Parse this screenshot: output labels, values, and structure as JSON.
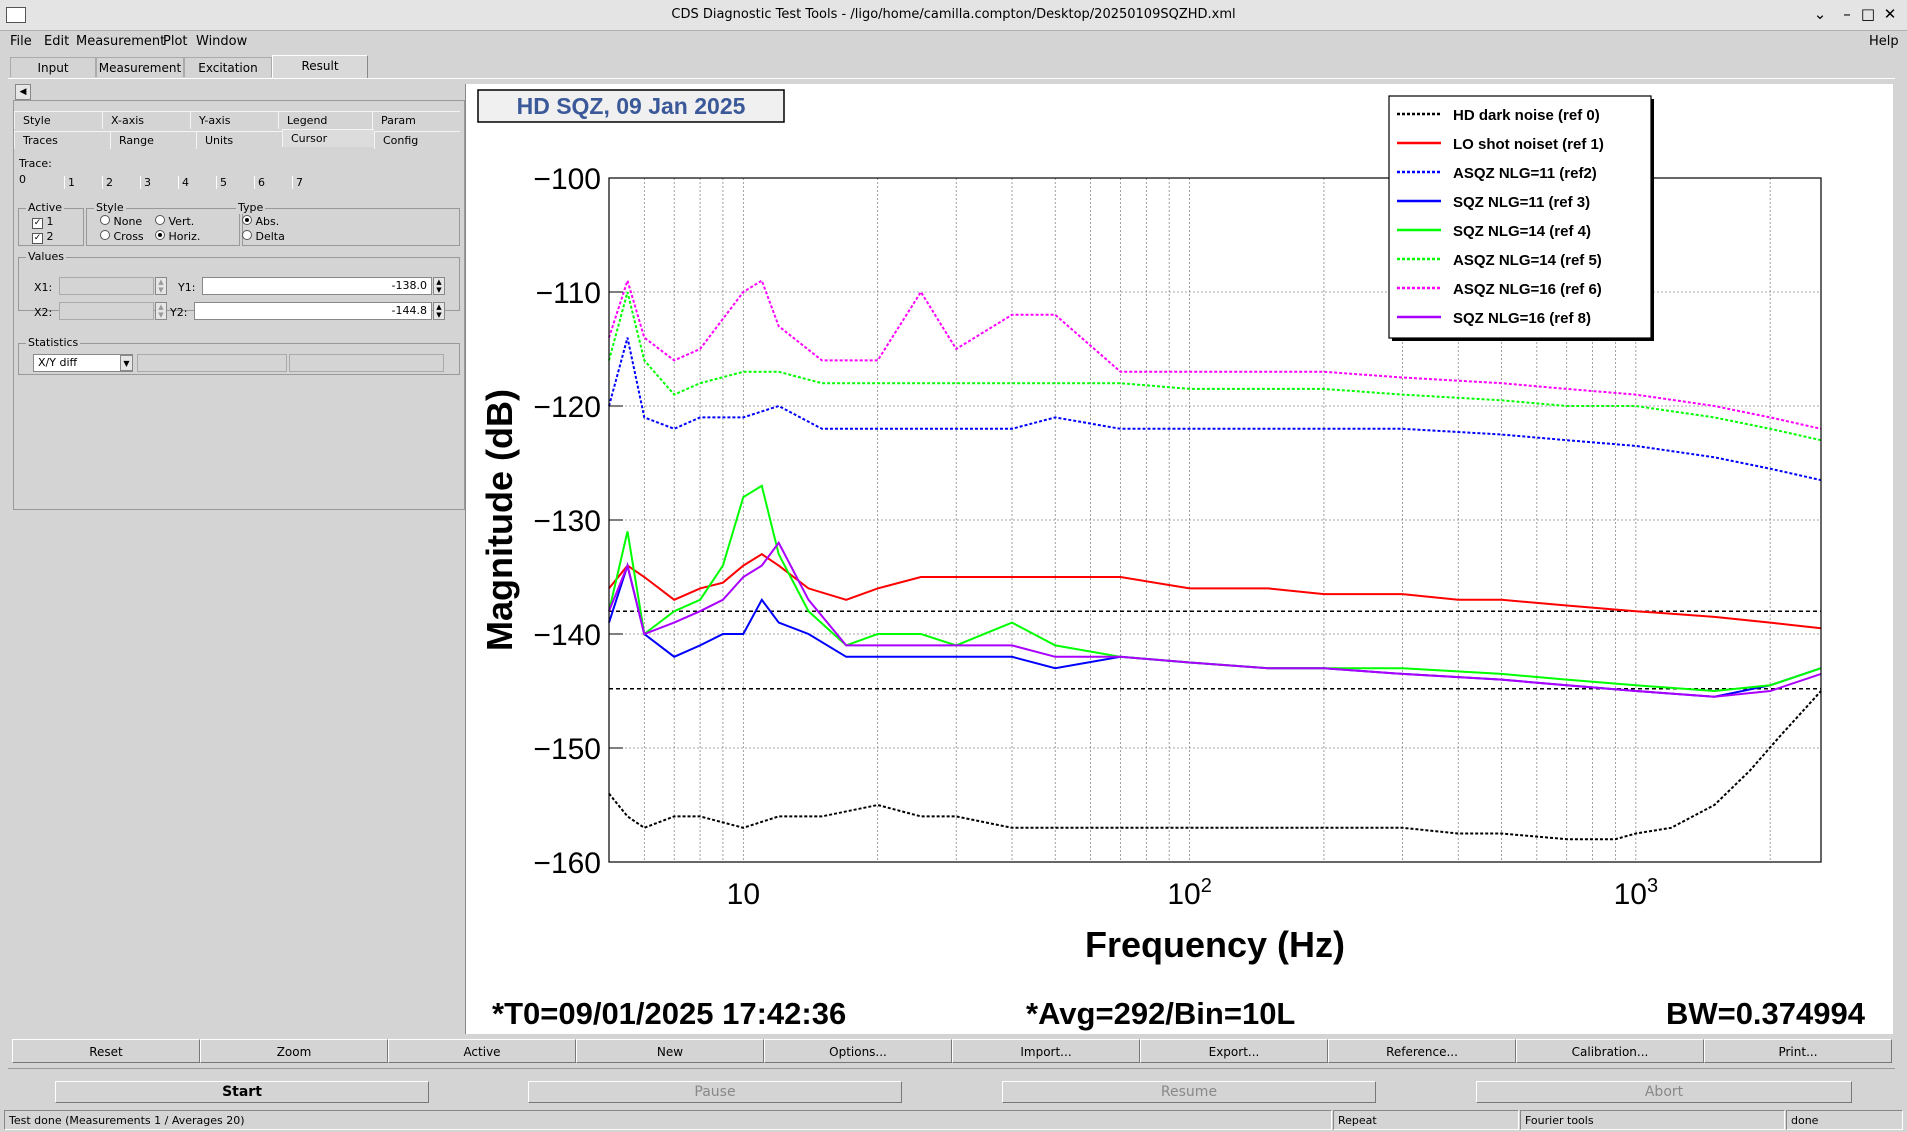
{
  "window": {
    "title": "CDS Diagnostic Test Tools - /ligo/home/camilla.compton/Desktop/20250109SQZHD.xml"
  },
  "menu": {
    "file": "File",
    "edit": "Edit",
    "measurement": "Measurement",
    "plot": "Plot",
    "window": "Window",
    "help": "Help"
  },
  "tabs": [
    "Input",
    "Measurement",
    "Excitation",
    "Result"
  ],
  "options": {
    "subtabs_row1": [
      "Style",
      "X-axis",
      "Y-axis",
      "Legend",
      "Param"
    ],
    "subtabs_row2": [
      "Traces",
      "Range",
      "Units",
      "Cursor",
      "Config"
    ],
    "trace_label": "Trace:",
    "trace_tabs": [
      "0",
      "1",
      "2",
      "3",
      "4",
      "5",
      "6",
      "7"
    ],
    "active": {
      "title": "Active",
      "item1": "1",
      "item2": "2"
    },
    "style": {
      "title": "Style",
      "none": "None",
      "vert": "Vert.",
      "cross": "Cross",
      "horiz": "Horiz."
    },
    "type": {
      "title": "Type",
      "abs": "Abs.",
      "delta": "Delta"
    },
    "values": {
      "title": "Values",
      "x1_label": "X1:",
      "x2_label": "X2:",
      "y1_label": "Y1:",
      "y2_label": "Y2:",
      "y1": "-138.0",
      "y2": "-144.8"
    },
    "statistics": {
      "title": "Statistics",
      "selected": "X/Y diff"
    }
  },
  "plot": {
    "info_t0": "*T0=09/01/2025 17:42:36",
    "info_avg": "*Avg=292/Bin=10L",
    "info_bw": "BW=0.374994"
  },
  "chart_data": {
    "type": "line",
    "title": "HD SQZ, 09 Jan 2025",
    "xlabel": "Frequency (Hz)",
    "ylabel": "Magnitude (dB)",
    "xscale": "log",
    "xlim": [
      5,
      2600
    ],
    "ylim": [
      -160,
      -100
    ],
    "ytick_labels": [
      "−100",
      "−110",
      "−120",
      "−130",
      "−140",
      "−150",
      "−160"
    ],
    "yticks": [
      -100,
      -110,
      -120,
      -130,
      -140,
      -150,
      -160
    ],
    "xtick_labels": [
      {
        "base": "10",
        "exp": ""
      },
      {
        "base": "10",
        "exp": "2"
      },
      {
        "base": "10",
        "exp": "3"
      }
    ],
    "xticks": [
      10,
      100,
      1000
    ],
    "grid": true,
    "legend_position": "top-right",
    "series": [
      {
        "name": "HD dark noise (ref 0)",
        "color": "#000000",
        "style": "dotted",
        "x": [
          5,
          5.5,
          6,
          7,
          8,
          10,
          12,
          15,
          20,
          25,
          30,
          40,
          50,
          70,
          100,
          150,
          200,
          300,
          400,
          500,
          700,
          900,
          1000,
          1200,
          1500,
          1800,
          2100,
          2400,
          2600
        ],
        "y": [
          -154,
          -156,
          -157,
          -156,
          -156,
          -157,
          -156,
          -156,
          -155,
          -156,
          -156,
          -157,
          -157,
          -157,
          -157,
          -157,
          -157,
          -157,
          -157.5,
          -157.5,
          -158,
          -158,
          -157.5,
          -157,
          -155,
          -152,
          -149,
          -146.5,
          -145
        ]
      },
      {
        "name": "LO shot noiset (ref 1)",
        "color": "#ff0000",
        "style": "solid",
        "x": [
          5,
          5.5,
          6,
          7,
          8,
          9,
          10,
          11,
          12,
          14,
          17,
          20,
          25,
          30,
          40,
          50,
          70,
          100,
          150,
          200,
          300,
          400,
          500,
          700,
          1000,
          1500,
          2000,
          2600
        ],
        "y": [
          -136,
          -134,
          -135,
          -137,
          -136,
          -135.5,
          -134,
          -133,
          -134,
          -136,
          -137,
          -136,
          -135,
          -135,
          -135,
          -135,
          -135,
          -136,
          -136,
          -136.5,
          -136.5,
          -137,
          -137,
          -137.5,
          -138,
          -138.5,
          -139,
          -139.5
        ]
      },
      {
        "name": "ASQZ NLG=11 (ref2)",
        "color": "#0000ff",
        "style": "dotted",
        "x": [
          5,
          5.5,
          6,
          7,
          8,
          10,
          12,
          15,
          20,
          25,
          30,
          40,
          50,
          70,
          100,
          200,
          300,
          500,
          700,
          1000,
          1500,
          2000,
          2600
        ],
        "y": [
          -120,
          -114,
          -121,
          -122,
          -121,
          -121,
          -120,
          -122,
          -122,
          -122,
          -122,
          -122,
          -121,
          -122,
          -122,
          -122,
          -122,
          -122.5,
          -123,
          -123.5,
          -124.5,
          -125.5,
          -126.5
        ]
      },
      {
        "name": "SQZ NLG=11 (ref 3)",
        "color": "#0000ff",
        "style": "solid",
        "x": [
          5,
          5.5,
          6,
          7,
          8,
          9,
          10,
          11,
          12,
          14,
          17,
          20,
          25,
          30,
          40,
          50,
          70,
          100,
          150,
          200,
          300,
          500,
          700,
          1000,
          1500,
          2000,
          2600
        ],
        "y": [
          -139,
          -134,
          -140,
          -142,
          -141,
          -140,
          -140,
          -137,
          -139,
          -140,
          -142,
          -142,
          -142,
          -142,
          -142,
          -143,
          -142,
          -142.5,
          -143,
          -143,
          -143.5,
          -144,
          -144.5,
          -145,
          -145.5,
          -144.5,
          -143
        ]
      },
      {
        "name": "SQZ NLG=14 (ref 4)",
        "color": "#00ff00",
        "style": "solid",
        "x": [
          5,
          5.5,
          6,
          7,
          8,
          9,
          10,
          11,
          12,
          14,
          17,
          20,
          25,
          30,
          40,
          50,
          70,
          100,
          150,
          200,
          300,
          500,
          700,
          1000,
          1500,
          2000,
          2600
        ],
        "y": [
          -138,
          -131,
          -140,
          -138,
          -137,
          -134,
          -128,
          -127,
          -133,
          -138,
          -141,
          -140,
          -140,
          -141,
          -139,
          -141,
          -142,
          -142.5,
          -143,
          -143,
          -143,
          -143.5,
          -144,
          -144.5,
          -145,
          -144.5,
          -143
        ]
      },
      {
        "name": "ASQZ NLG=14 (ref 5)",
        "color": "#00ff00",
        "style": "dotted",
        "x": [
          5,
          5.5,
          6,
          7,
          8,
          10,
          12,
          15,
          20,
          25,
          30,
          40,
          50,
          70,
          100,
          200,
          300,
          500,
          700,
          1000,
          1500,
          2000,
          2600
        ],
        "y": [
          -116,
          -110,
          -116,
          -119,
          -118,
          -117,
          -117,
          -118,
          -118,
          -118,
          -118,
          -118,
          -118,
          -118,
          -118.5,
          -118.5,
          -119,
          -119.5,
          -120,
          -120,
          -121,
          -122,
          -123
        ]
      },
      {
        "name": "ASQZ NLG=16 (ref 6)",
        "color": "#ff00ff",
        "style": "dotted",
        "x": [
          5,
          5.5,
          6,
          7,
          8,
          10,
          11,
          12,
          15,
          20,
          25,
          30,
          40,
          50,
          70,
          100,
          200,
          300,
          500,
          700,
          1000,
          1500,
          2000,
          2600
        ],
        "y": [
          -114,
          -109,
          -114,
          -116,
          -115,
          -110,
          -109,
          -113,
          -116,
          -116,
          -110,
          -115,
          -112,
          -112,
          -117,
          -117,
          -117,
          -117.5,
          -118,
          -118.5,
          -119,
          -120,
          -121,
          -122
        ]
      },
      {
        "name": "SQZ NLG=16 (ref 8)",
        "color": "#aa00ff",
        "style": "solid",
        "x": [
          5,
          5.5,
          6,
          7,
          8,
          9,
          10,
          11,
          12,
          14,
          17,
          20,
          25,
          30,
          40,
          50,
          70,
          100,
          150,
          200,
          300,
          500,
          700,
          1000,
          1500,
          2000,
          2600
        ],
        "y": [
          -138,
          -134,
          -140,
          -139,
          -138,
          -137,
          -135,
          -134,
          -132,
          -137,
          -141,
          -141,
          -141,
          -141,
          -141,
          -142,
          -142,
          -142.5,
          -143,
          -143,
          -143.5,
          -144,
          -144.5,
          -145,
          -145.5,
          -145,
          -143.5
        ]
      }
    ],
    "cursor_lines": [
      -138.0,
      -144.8
    ]
  },
  "buttons": {
    "row1": [
      "Reset",
      "Zoom",
      "Active",
      "New",
      "Options...",
      "Import...",
      "Export...",
      "Reference...",
      "Calibration...",
      "Print..."
    ],
    "start": "Start",
    "pause": "Pause",
    "resume": "Resume",
    "abort": "Abort"
  },
  "status": {
    "message": "Test done (Measurements 1 / Averages 20)",
    "repeat": "Repeat",
    "tool": "Fourier tools",
    "state": "done"
  },
  "colors": {
    "title_text": "#3b5998",
    "plot_bg": "#ffffff",
    "panel_bg": "#d4d4d4"
  }
}
